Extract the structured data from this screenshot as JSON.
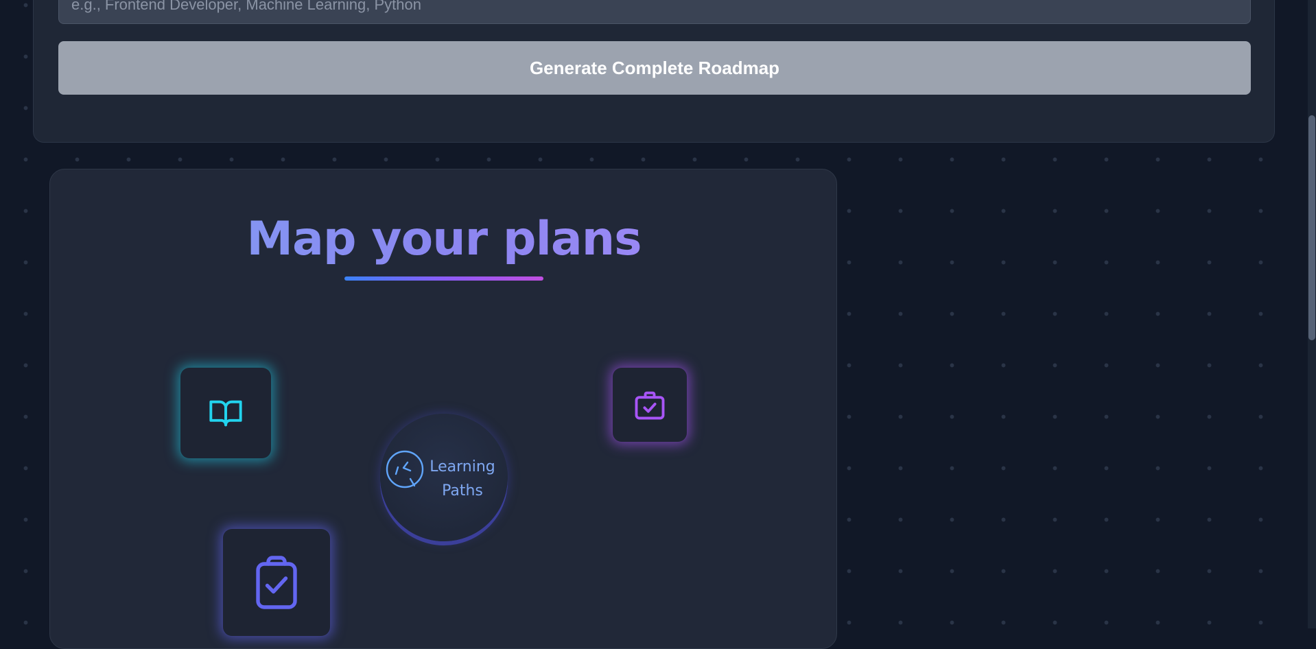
{
  "form": {
    "goal_placeholder": "e.g., Frontend Developer, Machine Learning, Python",
    "goal_value": "",
    "generate_button_label": "Generate Complete Roadmap"
  },
  "map": {
    "title": "Map your plans",
    "hub": {
      "label_line1": "Learning",
      "label_line2": "Paths",
      "icon": "compass-icon"
    },
    "tiles": [
      {
        "icon": "book-icon",
        "color": "#22d3ee"
      },
      {
        "icon": "briefcase-icon",
        "color": "#a855f7"
      },
      {
        "icon": "clipboard-check-icon",
        "color": "#6366f1"
      }
    ]
  },
  "colors": {
    "page_background": "#111827",
    "card_background": "#1f2736",
    "button_background": "#9ca3af",
    "title_gradient": [
      "#7fa3f5",
      "#a78bfa"
    ],
    "underline_gradient": [
      "#3b82f6",
      "#8b5cf6",
      "#c04fe0"
    ],
    "hub_text": "#7fa8f2"
  }
}
